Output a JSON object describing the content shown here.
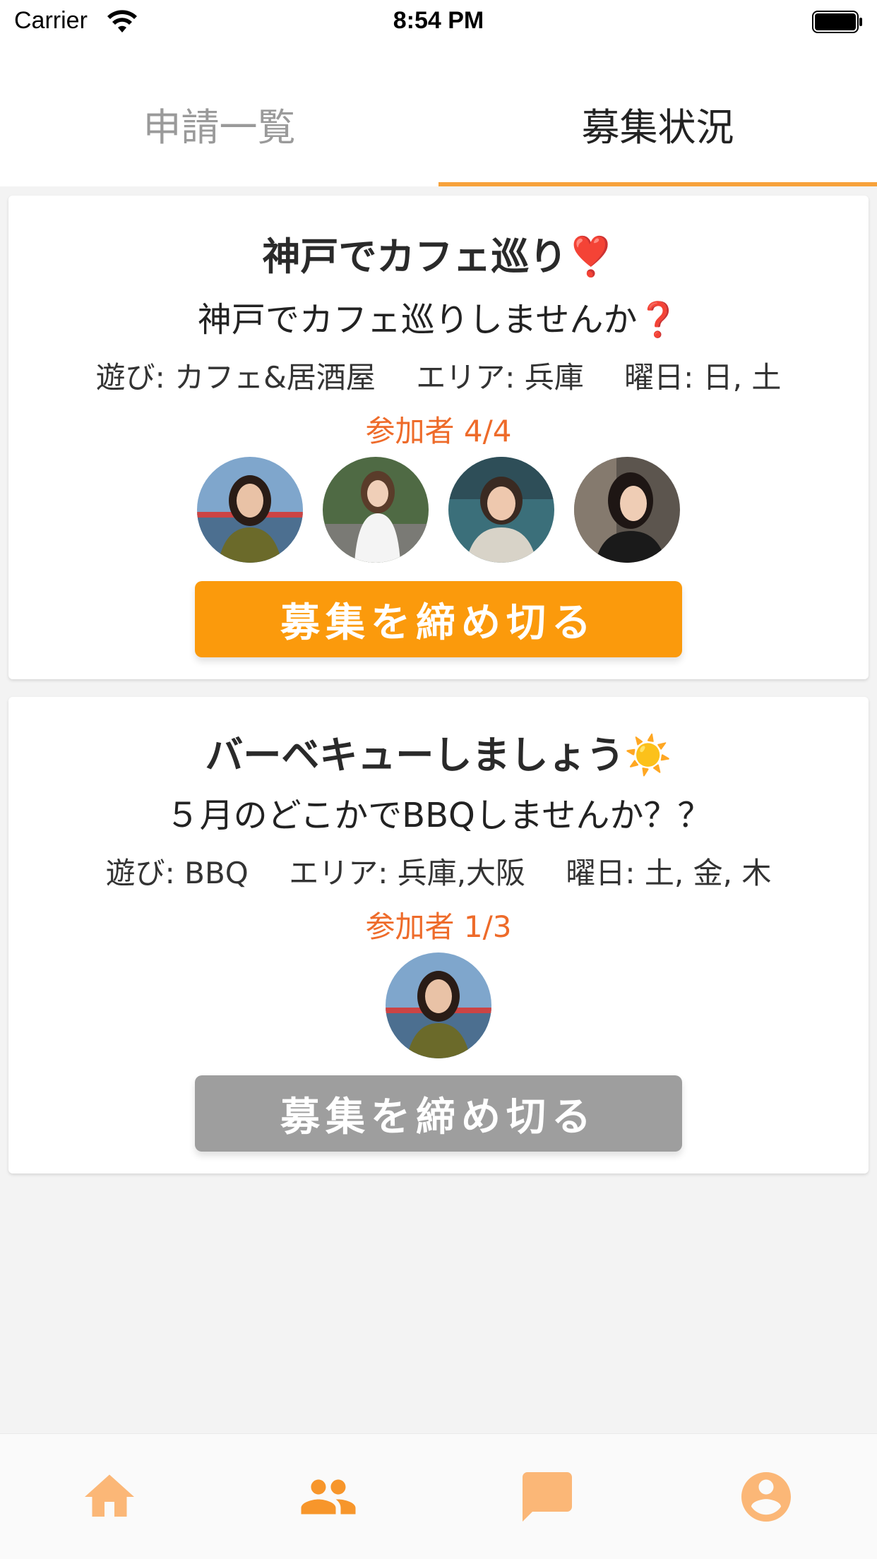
{
  "status_bar": {
    "carrier": "Carrier",
    "time": "8:54 PM"
  },
  "tabs": [
    {
      "label": "申請一覧",
      "active": false
    },
    {
      "label": "募集状況",
      "active": true
    }
  ],
  "colors": {
    "accent": "#f7a23b",
    "button_active": "#fb9a0c",
    "button_disabled": "#9e9e9e",
    "count": "#ee6b2a",
    "nav_icon": "#fbb777"
  },
  "cards": [
    {
      "title": "神戸でカフェ巡り❣️",
      "description": "神戸でカフェ巡りしませんか❓",
      "meta": {
        "play": "遊び: カフェ&居酒屋",
        "area": "エリア: 兵庫",
        "days": "曜日: 日, 土"
      },
      "participants": "参加者 4/4",
      "avatars": [
        "participant-photo-1",
        "participant-photo-2",
        "participant-photo-3",
        "participant-photo-4"
      ],
      "button": "募集を締め切る",
      "button_enabled": true
    },
    {
      "title": "バーベキューしましょう☀️",
      "description": "５月のどこかでBBQしませんか？？",
      "meta": {
        "play": "遊び: BBQ",
        "area": "エリア: 兵庫,大阪",
        "days": "曜日: 土, 金, 木"
      },
      "participants": "参加者 1/3",
      "avatars": [
        "participant-photo-1"
      ],
      "button": "募集を締め切る",
      "button_enabled": false
    }
  ],
  "bottom_nav": [
    {
      "icon": "home-icon"
    },
    {
      "icon": "people-icon",
      "active": true
    },
    {
      "icon": "chat-icon"
    },
    {
      "icon": "account-icon"
    }
  ]
}
